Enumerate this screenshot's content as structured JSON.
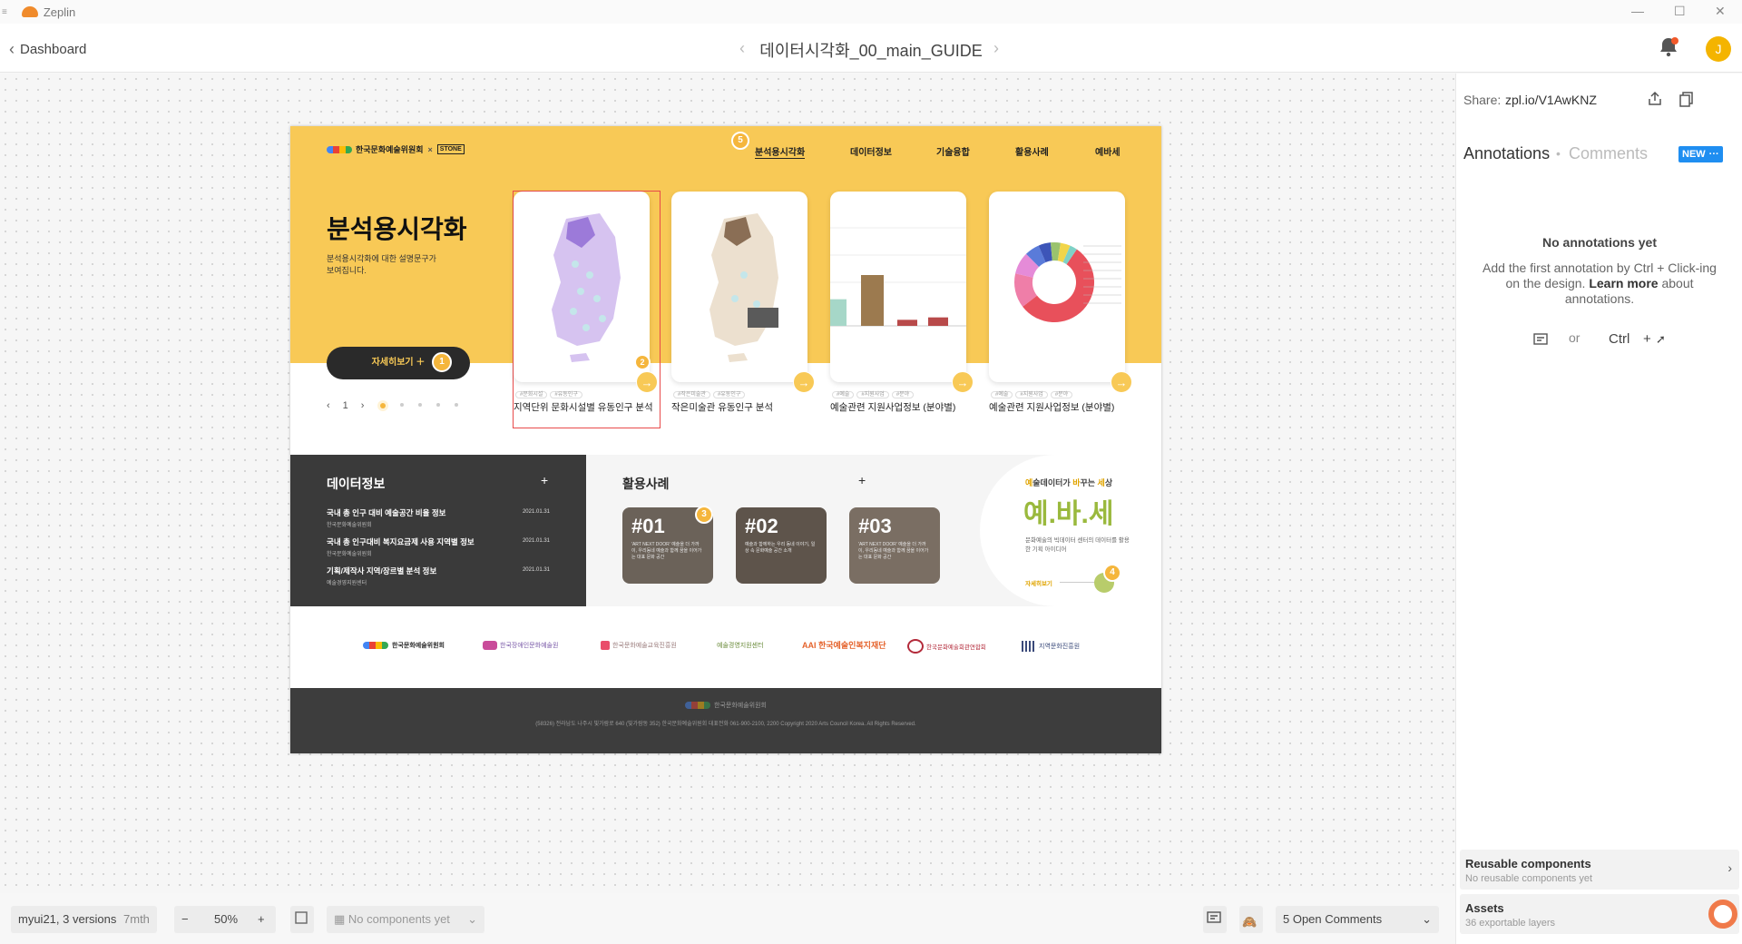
{
  "app": {
    "name": "Zeplin"
  },
  "toolbar": {
    "back_label": "Dashboard",
    "doc_title": "데이터시각화_00_main_GUIDE",
    "avatar_initial": "J"
  },
  "design": {
    "brand": "한국문화예술위원회",
    "brand_x": "×",
    "partner": "STONE",
    "nav": [
      "분석용시각화",
      "데이터정보",
      "기술융합",
      "활용사례",
      "예바세"
    ],
    "hero_title": "분석용시각화",
    "hero_desc": "분석용시각화에 대한 설명문구가 보여집니다.",
    "more_button": "자세히보기 ＋",
    "pager": {
      "page": "1"
    },
    "cards": [
      {
        "title": "지역단위 문화시설별 유동인구 분석",
        "tags": [
          "#문화시설",
          "#유동인구"
        ]
      },
      {
        "title": "작은미술관 유동인구 분석",
        "tags": [
          "#작은미술관",
          "#유동인구"
        ]
      },
      {
        "title": "예술관련 지원사업정보 (분야별)",
        "tags": [
          "#예술",
          "#지원사업",
          "#분야"
        ]
      },
      {
        "title": "예술관련 지원사업정보 (분야별)",
        "tags": [
          "#예술",
          "#지원사업",
          "#분야"
        ]
      }
    ],
    "data_info": {
      "title": "데이터정보",
      "plus": "+",
      "items": [
        {
          "title": "국내 총 인구 대비 예술공간 비율 정보",
          "source": "한국문화예술위원회",
          "date": "2021.01.31"
        },
        {
          "title": "국내 총 인구대비 복지요금제 사용 지역별 정보",
          "source": "한국문화예술위원회",
          "date": "2021.01.31"
        },
        {
          "title": "기획/제작사 지역/장르별 분석 정보",
          "source": "예술경영지원센터",
          "date": "2021.01.31"
        }
      ]
    },
    "cases": {
      "title": "활용사례",
      "plus": "+",
      "items": [
        {
          "num": "#01",
          "desc": "'ART NEXT DOOR' 예술을 더 가까이, 우리동네 예술과 함께 꿈을 이어가는 대표 문화 공간"
        },
        {
          "num": "#02",
          "desc": "예술과 함께하는 우리 동네 이야기, 일상 속 문화예술 공간 소개"
        },
        {
          "num": "#03",
          "desc": "'ART NEXT DOOR' 예술을 더 가까이, 우리동네 예술과 함께 꿈을 이어가는 대표 문화 공간"
        }
      ]
    },
    "yebase": {
      "tagline_parts": [
        "예",
        "술데이터가 ",
        "바",
        "꾸는 ",
        "세",
        "상"
      ],
      "logo": "예.바.세",
      "desc": "문화예술의 빅데이터 센터의 데이터를 활용한 기획 아이디어",
      "more": "자세히보기"
    },
    "partners": [
      "한국문화예술위원회",
      "한국장애인문화예술원",
      "한국문화예술교육진흥원",
      "예술경영지원센터",
      "AAI 한국예술인복지재단",
      "한국문화예술회관연합회",
      "지역문화진흥원"
    ],
    "footer": {
      "brand": "한국문화예술위원회",
      "address": "(58326) 전라남도 나주시 빛가람로 640 (빛가람동 352) 한국문화예술위원회   대표전화 061-900-2100, 2200   Copyright 2020 Arts Council Korea. All Rights Reserved."
    },
    "pins": [
      "1",
      "2",
      "3",
      "4",
      "5"
    ]
  },
  "panel": {
    "share_label": "Share:",
    "share_url": "zpl.io/V1AwKNZ",
    "tab_annotations": "Annotations",
    "tab_comments": "Comments",
    "sep": "•",
    "new_badge": "NEW",
    "badge_more": "···",
    "empty_title": "No annotations yet",
    "empty_pre": "Add the first annotation by Ctrl + Click-ing on the design. ",
    "learn_more": "Learn more",
    "empty_post": " about annotations.",
    "or": "or",
    "ctrl": "Ctrl",
    "plus": "+",
    "reusable": {
      "title": "Reusable components",
      "sub": "No reusable components yet"
    },
    "assets": {
      "title": "Assets",
      "sub": "36 exportable layers"
    }
  },
  "bottombar": {
    "version": "myui21, 3 versions",
    "age": "7mth",
    "minus": "−",
    "zoom": "50%",
    "plus": "+",
    "components": "No components yet",
    "open_comments": "5 Open Comments"
  },
  "chart_data": [
    {
      "type": "bar",
      "categories": [
        "",
        "",
        "",
        ""
      ],
      "values": [
        22,
        42,
        5,
        7
      ]
    },
    {
      "type": "pie",
      "values": [
        55,
        14,
        9,
        6,
        5,
        4,
        4,
        3
      ]
    }
  ]
}
